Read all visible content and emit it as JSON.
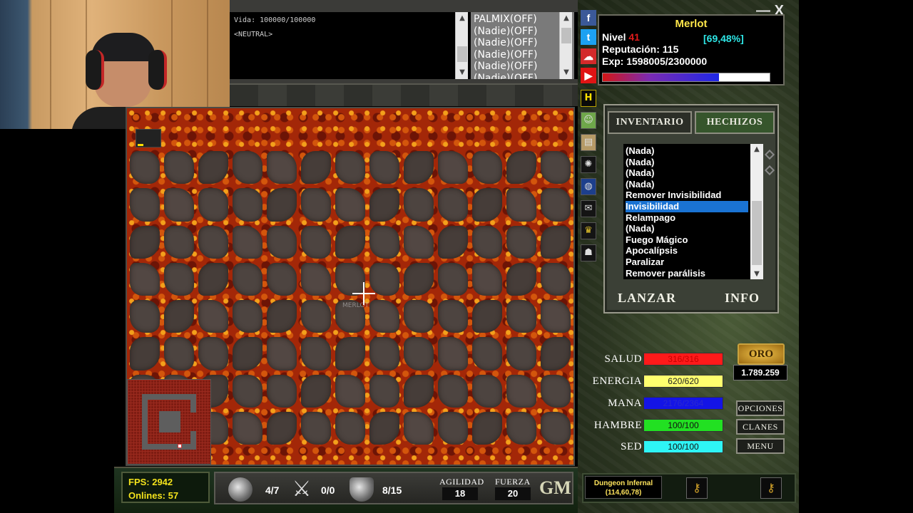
{
  "console": {
    "lines": [
      "Vida: 100000/100000",
      "",
      "<NEUTRAL>"
    ]
  },
  "users_online": [
    "PALMIX(OFF)",
    "(Nadie)(OFF)",
    "(Nadie)(OFF)",
    "(Nadie)(OFF)",
    "(Nadie)(OFF)",
    "(Nadie)(OFF)"
  ],
  "map": {
    "character_label": "MERLOT"
  },
  "status": {
    "fps": "FPS: 2942",
    "onlines": "Onlines: 57"
  },
  "toolbar": {
    "defense": "4/7",
    "weapon": "0/0",
    "shield": "8/15",
    "agilidad_label": "AGILIDAD",
    "agilidad": "18",
    "fuerza_label": "FUERZA",
    "fuerza": "20",
    "gm": "GM"
  },
  "character": {
    "name": "Merlot",
    "level_label": "Nivel",
    "level": "41",
    "level_pct": "[69,48%]",
    "reputation": "Reputación: 115",
    "exp": "Exp: 1598005/2300000",
    "exp_fraction": 0.6948
  },
  "window": {
    "close": "X",
    "minimize": "—"
  },
  "tabs": {
    "inventory": "INVENTARIO",
    "spells": "HECHIZOS"
  },
  "spells": [
    "(Nada)",
    "(Nada)",
    "(Nada)",
    "(Nada)",
    "Remover Invisibilidad",
    "Invisibilidad",
    "Relampago",
    "(Nada)",
    "Fuego Mágico",
    "Apocalípsis",
    "Paralizar",
    "Remover parálisis"
  ],
  "spell_selected_index": 5,
  "spell_actions": {
    "cast": "LANZAR",
    "info": "INFO"
  },
  "vitals": {
    "salud_label": "SALUD",
    "salud": "316/316",
    "energia_label": "ENERGIA",
    "energia": "620/620",
    "mana_label": "MANA",
    "mana": "2176/2364",
    "hambre_label": "HAMBRE",
    "hambre": "100/100",
    "sed_label": "SED",
    "sed": "100/100"
  },
  "colors": {
    "salud": "#ff1a1a",
    "energia": "#ffff6e",
    "mana": "#1414e6",
    "hambre": "#22e022",
    "sed": "#2ef5f5",
    "spell_selected": "#1a73d3",
    "name": "#ffe74a"
  },
  "gold": {
    "button": "ORO",
    "amount": "1.789.259"
  },
  "menu": {
    "opciones": "OPCIONES",
    "clanes": "CLANES",
    "menu": "MENU"
  },
  "location": {
    "name": "Dungeon Infernal",
    "coords": "(114,60,78)"
  }
}
